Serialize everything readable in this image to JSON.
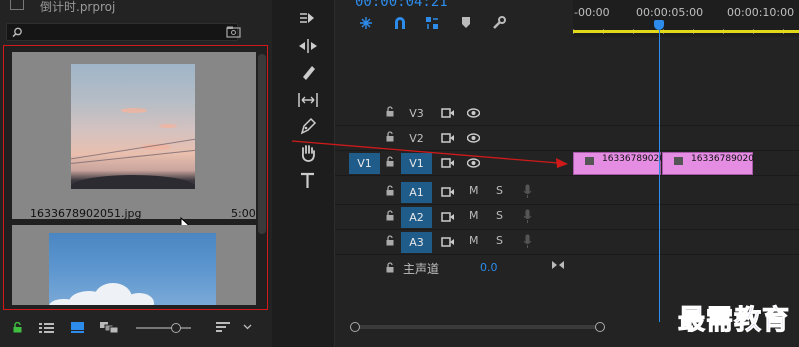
{
  "project": {
    "title": "倒计时.prproj",
    "search": {
      "placeholder": "",
      "value": ""
    },
    "items": [
      {
        "name": "1633678902051.jpg",
        "duration": "5:00"
      },
      {
        "name": "",
        "duration": ""
      }
    ]
  },
  "timeline": {
    "timecode": "00:00:04:21",
    "ruler": [
      "-00:00",
      "00:00:05:00",
      "00:00:10:00"
    ],
    "source_patch": "V1",
    "video_tracks": [
      "V3",
      "V2",
      "V1"
    ],
    "audio_tracks": [
      "A1",
      "A2",
      "A3"
    ],
    "mute_label": "M",
    "solo_label": "S",
    "master": {
      "label": "主声道",
      "value": "0.0"
    },
    "clips": [
      "16336789020",
      "16336789020"
    ]
  },
  "watermark": "最需教育",
  "colors": {
    "accent": "#2d8ceb",
    "clip": "#e58de3",
    "selection_border": "#d01a1a",
    "work_area": "#e2d91b",
    "track_target": "#1f5c8a"
  },
  "icons": [
    "file-icon",
    "search-icon",
    "new-bin-icon",
    "lock-icon",
    "list-view-icon",
    "icon-view-icon",
    "freeform-view-icon",
    "sort-icon",
    "chevron-down-icon",
    "track-select-icon",
    "ripple-edit-icon",
    "razor-icon",
    "slip-icon",
    "pen-icon",
    "hand-icon",
    "type-icon",
    "snap-icon",
    "linked-selection-icon",
    "add-marker-icon",
    "marker-icon",
    "wrench-icon",
    "toggle-output-icon",
    "eye-icon",
    "microphone-icon",
    "stereo-icon"
  ]
}
